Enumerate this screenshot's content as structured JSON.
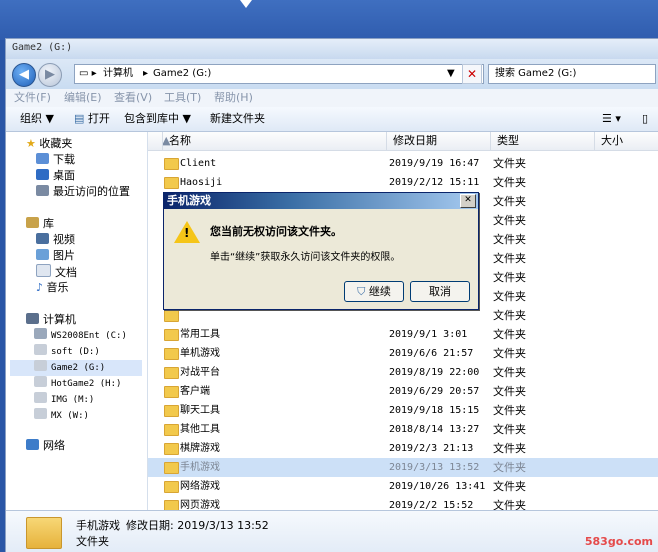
{
  "window": {
    "title": "Game2 (G:)"
  },
  "address": {
    "segments": [
      "计算机",
      "Game2 (G:)"
    ],
    "search_placeholder": "搜索 Game2 (G:)"
  },
  "menu": [
    "文件(F)",
    "编辑(E)",
    "查看(V)",
    "工具(T)",
    "帮助(H)"
  ],
  "toolbar": {
    "organize": "组织 ▼",
    "open": "打开",
    "include": "包含到库中 ▼",
    "new_folder": "新建文件夹"
  },
  "sidebar": {
    "favorites": "收藏夹",
    "fav_items": [
      "下载",
      "桌面",
      "最近访问的位置"
    ],
    "libraries": "库",
    "lib_items": [
      "视频",
      "图片",
      "文档",
      "音乐"
    ],
    "computer": "计算机",
    "drives": [
      "WS2008Ent (C:)",
      "soft (D:)",
      "Game2 (G:)",
      "HotGame2 (H:)",
      "IMG (M:)",
      "MX (W:)"
    ],
    "network": "网络"
  },
  "columns": {
    "name": "名称",
    "date": "修改日期",
    "type": "类型",
    "size": "大小"
  },
  "files": [
    {
      "name": "Client",
      "date": "2019/9/19 16:47",
      "type": "文件夹"
    },
    {
      "name": "Haosiji",
      "date": "2019/2/12 15:11",
      "type": "文件夹"
    },
    {
      "name": "",
      "date": "",
      "type": "文件夹"
    },
    {
      "name": "",
      "date": "",
      "type": "文件夹"
    },
    {
      "name": "",
      "date": "",
      "type": "文件夹"
    },
    {
      "name": "",
      "date": "",
      "type": "文件夹"
    },
    {
      "name": "",
      "date": "",
      "type": "文件夹"
    },
    {
      "name": "",
      "date": "",
      "type": "文件夹"
    },
    {
      "name": "",
      "date": "",
      "type": "文件夹"
    },
    {
      "name": "常用工具",
      "date": "2019/9/1 3:01",
      "type": "文件夹"
    },
    {
      "name": "单机游戏",
      "date": "2019/6/6 21:57",
      "type": "文件夹"
    },
    {
      "name": "对战平台",
      "date": "2019/8/19 22:00",
      "type": "文件夹"
    },
    {
      "name": "客户端",
      "date": "2019/6/29 20:57",
      "type": "文件夹"
    },
    {
      "name": "聊天工具",
      "date": "2019/9/18 15:15",
      "type": "文件夹"
    },
    {
      "name": "其他工具",
      "date": "2018/8/14 13:27",
      "type": "文件夹"
    },
    {
      "name": "棋牌游戏",
      "date": "2019/2/3 21:13",
      "type": "文件夹"
    },
    {
      "name": "手机游戏",
      "date": "2019/3/13 13:52",
      "type": "文件夹",
      "selected": true
    },
    {
      "name": "网络游戏",
      "date": "2019/10/26 13:41",
      "type": "文件夹"
    },
    {
      "name": "网页游戏",
      "date": "2019/2/2 15:52",
      "type": "文件夹"
    },
    {
      "name": "",
      "date": "",
      "type": "文件夹"
    }
  ],
  "status": {
    "name": "手机游戏",
    "modified": "修改日期: 2019/3/13 13:52",
    "kind": "文件夹"
  },
  "watermark": "583go.com",
  "dialog": {
    "title": "手机游戏",
    "heading": "您当前无权访问该文件夹。",
    "body": "单击“继续”获取永久访问该文件夹的权限。",
    "continue": "继续",
    "cancel": "取消"
  }
}
